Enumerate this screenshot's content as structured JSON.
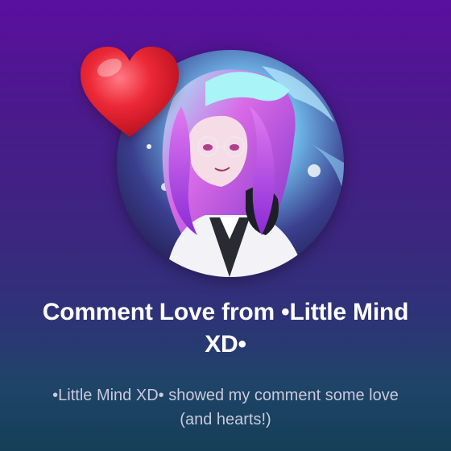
{
  "notification": {
    "title": "Comment Love from •Little Mind XD•",
    "message": "•Little Mind XD• showed my comment some love (and hearts!)",
    "icon": "heart-icon",
    "avatar": "user-avatar"
  },
  "colors": {
    "background_top": "#5a0f9e",
    "background_bottom": "#153f58",
    "heart": "#e8202e",
    "title": "#ffffff",
    "message": "#c9c9dc"
  }
}
